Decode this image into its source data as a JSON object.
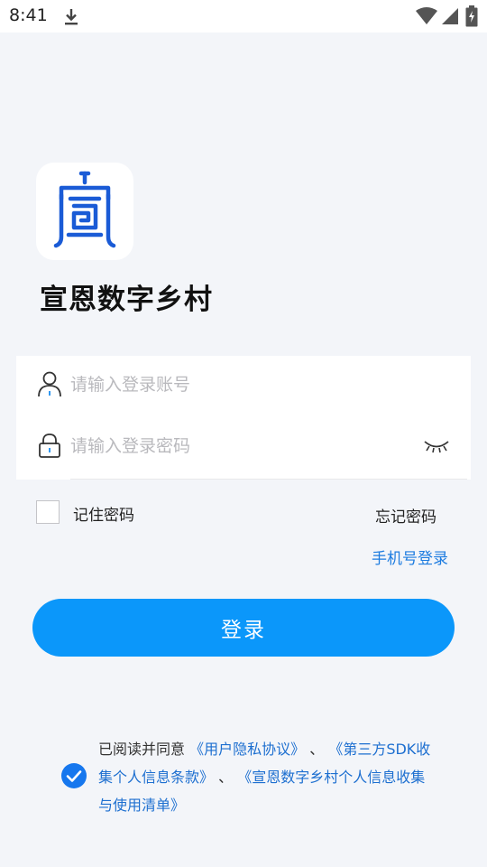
{
  "status_bar": {
    "time": "8:41"
  },
  "app": {
    "title": "宣恩数字乡村"
  },
  "form": {
    "account_placeholder": "请输入登录账号",
    "account_value": "",
    "password_placeholder": "请输入登录密码",
    "password_value": ""
  },
  "options": {
    "remember_label": "记住密码",
    "remember_checked": false,
    "forgot_label": "忘记密码",
    "phone_login_label": "手机号登录"
  },
  "login_button": {
    "label": "登录"
  },
  "agreement": {
    "checked": true,
    "prefix": "已阅读并同意",
    "link1": "《用户隐私协议》",
    "sep1": "、",
    "link2": "《第三方SDK收集个人信息条款》",
    "sep2": "、",
    "link3": "《宣恩数字乡村个人信息收集与使用清单》"
  },
  "colors": {
    "primary": "#0b97fa",
    "link": "#1d6fd0",
    "background": "#f3f5f9",
    "logo_blue": "#1a5bd6"
  },
  "icons": [
    "download-icon",
    "wifi-icon",
    "signal-icon",
    "battery-icon",
    "user-icon",
    "lock-icon",
    "eye-closed-icon",
    "checkmark-icon"
  ]
}
